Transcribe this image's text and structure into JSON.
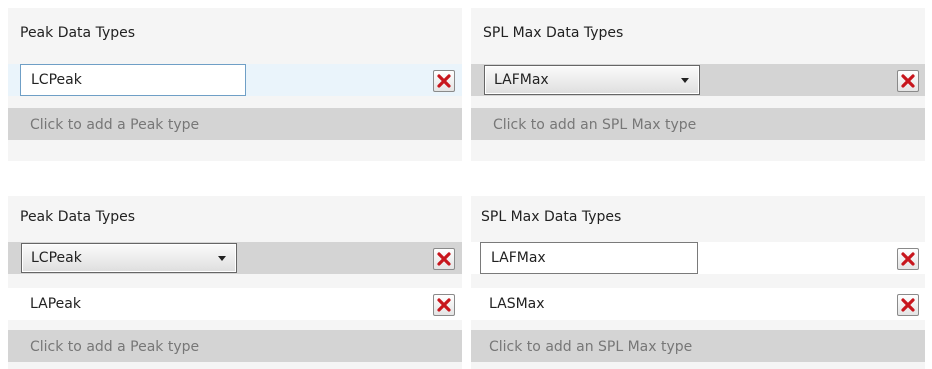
{
  "panels": [
    {
      "title": "Peak Data Types",
      "rows": [
        {
          "kind": "textbox",
          "value": "LCPeak"
        }
      ],
      "add_label": "Click to add a Peak type"
    },
    {
      "title": "SPL Max Data Types",
      "rows": [
        {
          "kind": "combo",
          "value": "LAFMax"
        }
      ],
      "add_label": "Click to add an SPL Max type"
    },
    {
      "title": "Peak Data Types",
      "rows": [
        {
          "kind": "combo",
          "value": "LCPeak"
        },
        {
          "kind": "static",
          "value": "LAPeak"
        }
      ],
      "add_label": "Click to add a Peak type"
    },
    {
      "title": "SPL Max Data Types",
      "rows": [
        {
          "kind": "textbox",
          "value": "LAFMax"
        },
        {
          "kind": "static",
          "value": "LASMax"
        }
      ],
      "add_label": "Click to add an SPL Max type"
    }
  ],
  "icons": {
    "delete": "close-icon",
    "dropdown": "chevron-down-icon"
  },
  "colors": {
    "delete_x": "#c8161d",
    "add_row": "#d4d4d4",
    "panel_bg": "#f5f5f5"
  }
}
